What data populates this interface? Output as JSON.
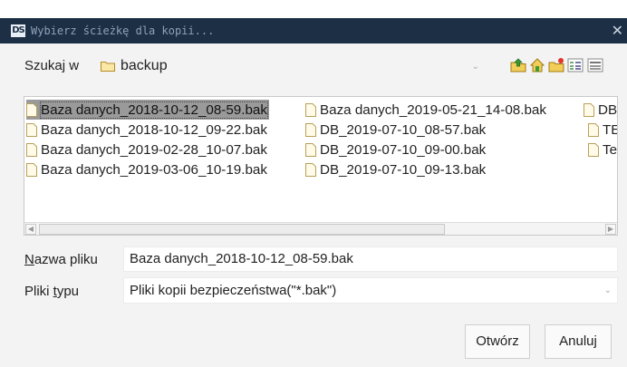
{
  "window": {
    "logo": "DS",
    "title": "Wybierz ścieżkę dla kopii...",
    "close": "✕"
  },
  "lookin": {
    "label": "Szukaj w",
    "value": "backup"
  },
  "toolbar": {
    "icons": [
      "up-folder-icon",
      "home-icon",
      "new-folder-icon",
      "list-view-icon",
      "details-view-icon"
    ]
  },
  "files": {
    "col1": [
      "Baza danych_2018-10-12_08-59.bak",
      "Baza danych_2018-10-12_09-22.bak",
      "Baza danych_2019-02-28_10-07.bak",
      "Baza danych_2019-03-06_10-19.bak"
    ],
    "col2": [
      "Baza danych_2019-05-21_14-08.bak",
      "DB_2019-07-10_08-57.bak",
      "DB_2019-07-10_09-00.bak",
      "DB_2019-07-10_09-13.bak"
    ],
    "col3": [
      "DB_",
      "TES",
      "Tes"
    ],
    "selected": "Baza danych_2018-10-12_08-59.bak"
  },
  "filename": {
    "label_u": "N",
    "label_rest": "azwa pliku",
    "value": "Baza danych_2018-10-12_08-59.bak"
  },
  "filetype": {
    "label_pre": "Pliki ",
    "label_u": "t",
    "label_rest": "ypu",
    "value": "Pliki kopii bezpieczeństwa(\"*.bak\")"
  },
  "buttons": {
    "open": "Otwórz",
    "cancel": "Anuluj"
  },
  "colors": {
    "titlebar": "#1c2f45",
    "selection": "#9a9a9a",
    "folder": "#f0c75e"
  }
}
